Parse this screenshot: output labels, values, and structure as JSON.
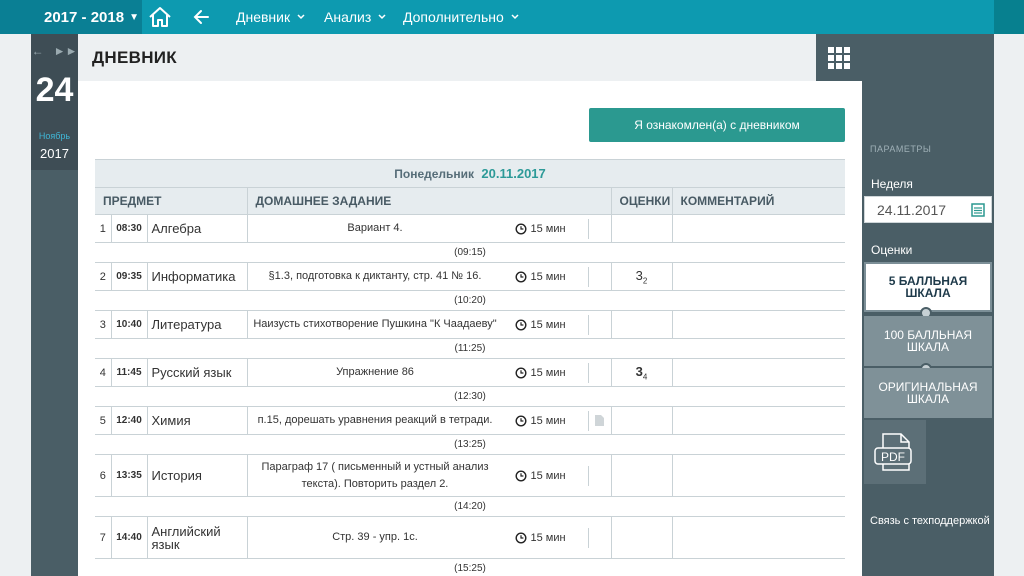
{
  "topbar": {
    "year": "2017 - 2018",
    "menu": [
      {
        "label": "Дневник"
      },
      {
        "label": "Анализ"
      },
      {
        "label": "Дополнительно"
      }
    ]
  },
  "date": {
    "day": "24",
    "month": "Ноябрь",
    "year": "2017"
  },
  "header": {
    "title": "ДНЕВНИК"
  },
  "main": {
    "ack_button": "Я ознакомлен(а) с дневником",
    "day_label": "Понедельник",
    "day_date": "20.11.2017",
    "columns": {
      "subject": "ПРЕДМЕТ",
      "homework": "ДОМАШНЕЕ ЗАДАНИЕ",
      "grades": "ОЦЕНКИ",
      "comment": "КОММЕНТАРИЙ"
    },
    "lessons": [
      {
        "num": "1",
        "time": "08:30",
        "subject": "Алгебра",
        "homework": "Вариант 4.",
        "duration": "15 мин",
        "grade": "",
        "grade_sub": "",
        "break": "(09:15)"
      },
      {
        "num": "2",
        "time": "09:35",
        "subject": "Информатика",
        "homework": "§1.3, подготовка к диктанту, стр. 41 № 16.",
        "duration": "15 мин",
        "grade": "3",
        "grade_sub": "2",
        "break": "(10:20)"
      },
      {
        "num": "3",
        "time": "10:40",
        "subject": "Литература",
        "homework": "Наизусть стихотворение Пушкина \"К Чаадаеву\"",
        "duration": "15 мин",
        "grade": "",
        "grade_sub": "",
        "break": "(11:25)"
      },
      {
        "num": "4",
        "time": "11:45",
        "subject": "Русский язык",
        "homework": "Упражнение 86",
        "duration": "15 мин",
        "grade": "3",
        "grade_sub": "4",
        "break": "(12:30)"
      },
      {
        "num": "5",
        "time": "12:40",
        "subject": "Химия",
        "homework": "п.15, дорешать уравнения реакций в тетради.",
        "duration": "15 мин",
        "grade": "",
        "grade_sub": "",
        "break": "(13:25)"
      },
      {
        "num": "6",
        "time": "13:35",
        "subject": "История",
        "homework": "Параграф 17 ( письменный и устный анализ текста). Повторить раздел 2.",
        "duration": "15 мин",
        "grade": "",
        "grade_sub": "",
        "break": "(14:20)"
      },
      {
        "num": "7",
        "time": "14:40",
        "subject": "Английский язык",
        "homework": "Стр. 39 - упр. 1с.",
        "duration": "15 мин",
        "grade": "",
        "grade_sub": "",
        "break": "(15:25)"
      }
    ]
  },
  "sidebar": {
    "params": "ПАРАМЕТРЫ",
    "week_label": "Неделя",
    "week_value": "24.11.2017",
    "grades_label": "Оценки",
    "scales": [
      "5 БАЛЛЬНАЯ ШКАЛА",
      "100 БАЛЛЬНАЯ ШКАЛА",
      "ОРИГИНАЛЬНАЯ ШКАЛА"
    ],
    "pdf_label": "PDF",
    "support": "Связь с техподдержкой"
  },
  "colors": {
    "topbar": "#0d9ab0",
    "accent": "#2b9990",
    "panel": "#4a5e66"
  }
}
